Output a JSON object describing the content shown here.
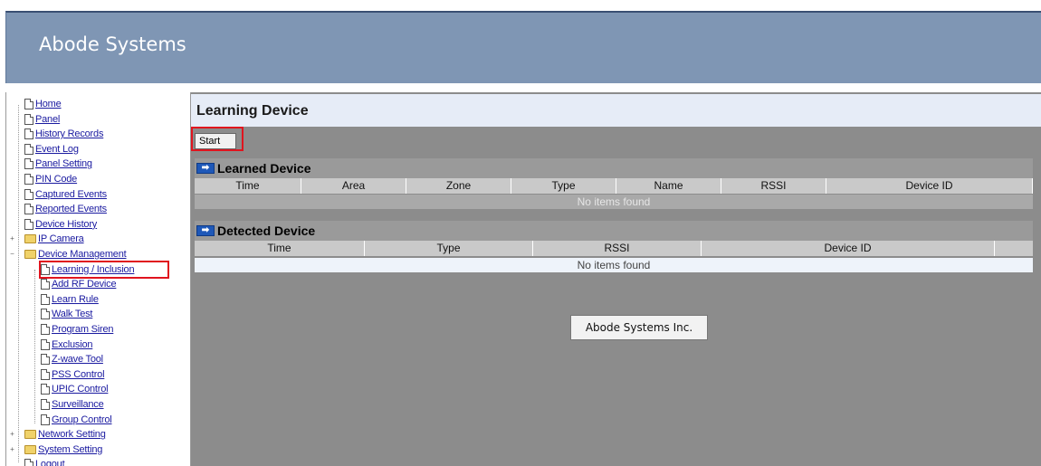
{
  "app": {
    "title": "Abode Systems"
  },
  "sidebar": {
    "items": [
      {
        "label": "Home",
        "icon": "doc-icon"
      },
      {
        "label": "Panel",
        "icon": "doc-icon"
      },
      {
        "label": "History Records",
        "icon": "doc-icon"
      },
      {
        "label": "Event Log",
        "icon": "doc-icon"
      },
      {
        "label": "Panel Setting",
        "icon": "doc-icon"
      },
      {
        "label": "PIN Code",
        "icon": "doc-icon"
      },
      {
        "label": "Captured Events",
        "icon": "doc-icon"
      },
      {
        "label": "Reported Events",
        "icon": "doc-icon"
      },
      {
        "label": "Device History",
        "icon": "doc-icon"
      },
      {
        "label": "IP Camera",
        "icon": "folder-icon"
      },
      {
        "label": "Device Management",
        "icon": "folder-icon"
      },
      {
        "label": "Learning / Inclusion",
        "icon": "doc-icon",
        "selected": true
      },
      {
        "label": "Add RF Device",
        "icon": "doc-icon"
      },
      {
        "label": "Learn Rule",
        "icon": "doc-icon"
      },
      {
        "label": "Walk Test",
        "icon": "doc-icon"
      },
      {
        "label": "Program Siren",
        "icon": "doc-icon"
      },
      {
        "label": "Exclusion",
        "icon": "doc-icon"
      },
      {
        "label": "Z-wave Tool",
        "icon": "doc-icon"
      },
      {
        "label": "PSS Control",
        "icon": "doc-icon"
      },
      {
        "label": "UPIC Control",
        "icon": "doc-icon"
      },
      {
        "label": "Surveillance",
        "icon": "doc-icon"
      },
      {
        "label": "Group Control",
        "icon": "doc-icon"
      },
      {
        "label": "Network Setting",
        "icon": "folder-icon"
      },
      {
        "label": "System Setting",
        "icon": "folder-icon"
      },
      {
        "label": "Logout",
        "icon": "doc-icon"
      }
    ]
  },
  "main": {
    "title": "Learning Device",
    "start_label": "Start",
    "learned": {
      "heading": "Learned Device",
      "columns": [
        "Time",
        "Area",
        "Zone",
        "Type",
        "Name",
        "RSSI",
        "Device ID"
      ],
      "empty_text": "No items found"
    },
    "detected": {
      "heading": "Detected Device",
      "columns": [
        "Time",
        "Type",
        "RSSI",
        "Device ID"
      ],
      "empty_text": "No items found"
    },
    "footer": "Abode Systems Inc."
  },
  "colors": {
    "header_bg": "#7f96b4",
    "highlight": "#e0141e",
    "content_bg": "#8c8c8c",
    "link": "#1a1aa0"
  }
}
